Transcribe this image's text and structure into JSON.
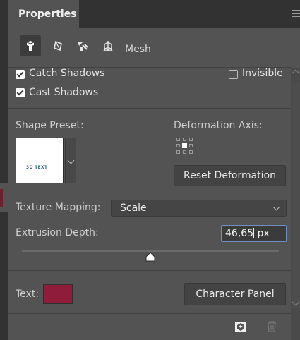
{
  "panel": {
    "tab_title": "Properties",
    "tools": [
      {
        "icon": "scene-3d-icon",
        "active": true
      },
      {
        "icon": "environment-3d-icon",
        "active": false
      },
      {
        "icon": "light-3d-icon",
        "active": false
      },
      {
        "icon": "camera-3d-icon",
        "active": false
      }
    ],
    "mesh_label": "Mesh"
  },
  "shadows": {
    "catch_label": "Catch Shadows",
    "catch_checked": true,
    "cast_label": "Cast Shadows",
    "cast_checked": true,
    "invisible_label": "Invisible",
    "invisible_checked": false
  },
  "shape_preset": {
    "label": "Shape Preset:",
    "thumbnail_text": "3D TEXT"
  },
  "deformation": {
    "axis_label": "Deformation Axis:",
    "reset_button": "Reset Deformation"
  },
  "texture_mapping": {
    "label": "Texture Mapping:",
    "value": "Scale"
  },
  "extrusion": {
    "label": "Extrusion Depth:",
    "value": "46,65",
    "unit": "px",
    "slider_fraction": 0.5
  },
  "text": {
    "label": "Text:",
    "color": "#8f1c3b",
    "character_panel_button": "Character Panel"
  },
  "footer": {
    "icons": [
      "render-icon",
      "trash-icon"
    ]
  },
  "colors": {
    "panel_bg": "#535353",
    "dark_bg": "#323232",
    "input_focus": "#6f8fbf"
  }
}
